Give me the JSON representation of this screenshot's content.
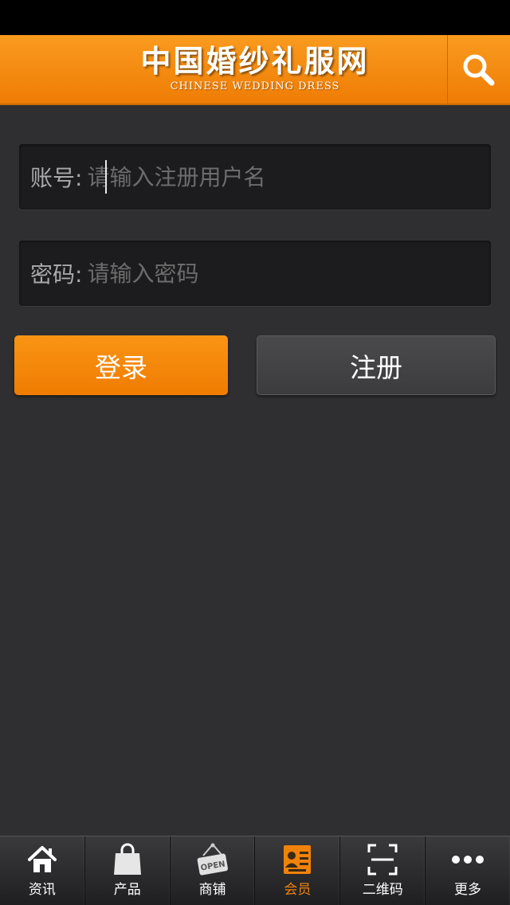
{
  "header": {
    "logo_cn": "中国婚纱礼服网",
    "logo_en": "CHINESE WEDDING DRESS",
    "search_icon": "search-icon"
  },
  "login_form": {
    "account_label": "账号:",
    "account_placeholder": "请输入注册用户名",
    "account_value": "",
    "password_label": "密码:",
    "password_placeholder": "请输入密码",
    "password_value": "",
    "login_label": "登录",
    "register_label": "注册"
  },
  "tabbar": {
    "tabs": [
      {
        "label": "资讯",
        "icon": "home-icon",
        "active": false
      },
      {
        "label": "产品",
        "icon": "shopping-bag-icon",
        "active": false
      },
      {
        "label": "商铺",
        "icon": "open-sign-icon",
        "active": false
      },
      {
        "label": "会员",
        "icon": "member-card-icon",
        "active": true
      },
      {
        "label": "二维码",
        "icon": "qr-scan-icon",
        "active": false
      },
      {
        "label": "更多",
        "icon": "more-icon",
        "active": false
      }
    ]
  },
  "colors": {
    "accent": "#f0820a",
    "header_top": "#f99b1f",
    "background": "#2f2f31",
    "field_background": "#1c1c1e",
    "register_button": "#444446"
  }
}
